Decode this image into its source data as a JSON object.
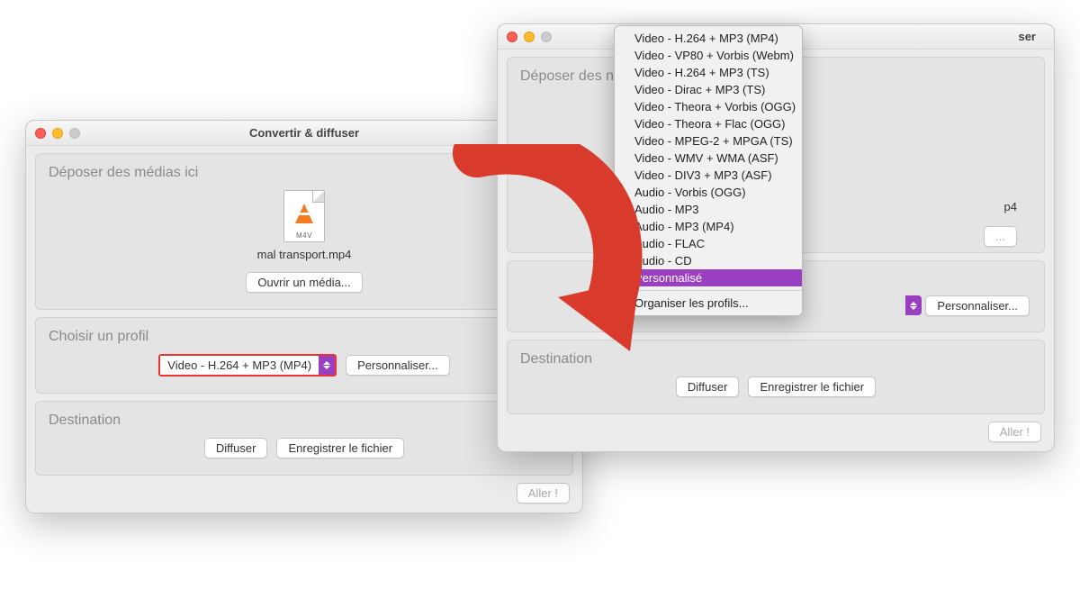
{
  "window1": {
    "title": "Convertir & diffuser",
    "section_deposit": "Déposer des médias ici",
    "file_ext": "M4V",
    "filename": "mal transport.mp4",
    "open_media_btn": "Ouvrir un média...",
    "section_profile": "Choisir un profil",
    "profile_selected": "Video - H.264 + MP3 (MP4)",
    "customize_btn": "Personnaliser...",
    "section_destination": "Destination",
    "diffuse_btn": "Diffuser",
    "save_file_btn": "Enregistrer le fichier",
    "go_btn": "Aller !"
  },
  "window2": {
    "title": "ser",
    "section_deposit_partial": "Déposer des n",
    "file_partial": "p4",
    "customize_btn": "Personnaliser...",
    "section_destination": "Destination",
    "diffuse_btn": "Diffuser",
    "save_file_btn": "Enregistrer le fichier",
    "go_btn": "Aller !"
  },
  "dropdown": {
    "items": [
      "Video - H.264 + MP3 (MP4)",
      "Video - VP80 + Vorbis (Webm)",
      "Video - H.264 + MP3 (TS)",
      "Video - Dirac + MP3 (TS)",
      "Video - Theora + Vorbis (OGG)",
      "Video - Theora + Flac (OGG)",
      "Video - MPEG-2 + MPGA (TS)",
      "Video - WMV + WMA (ASF)",
      "Video - DIV3 + MP3 (ASF)",
      "Audio - Vorbis (OGG)",
      "Audio - MP3",
      "Audio - MP3 (MP4)",
      "Audio - FLAC",
      "Audio - CD",
      "Personnalisé"
    ],
    "organize": "Organiser les profils..."
  }
}
